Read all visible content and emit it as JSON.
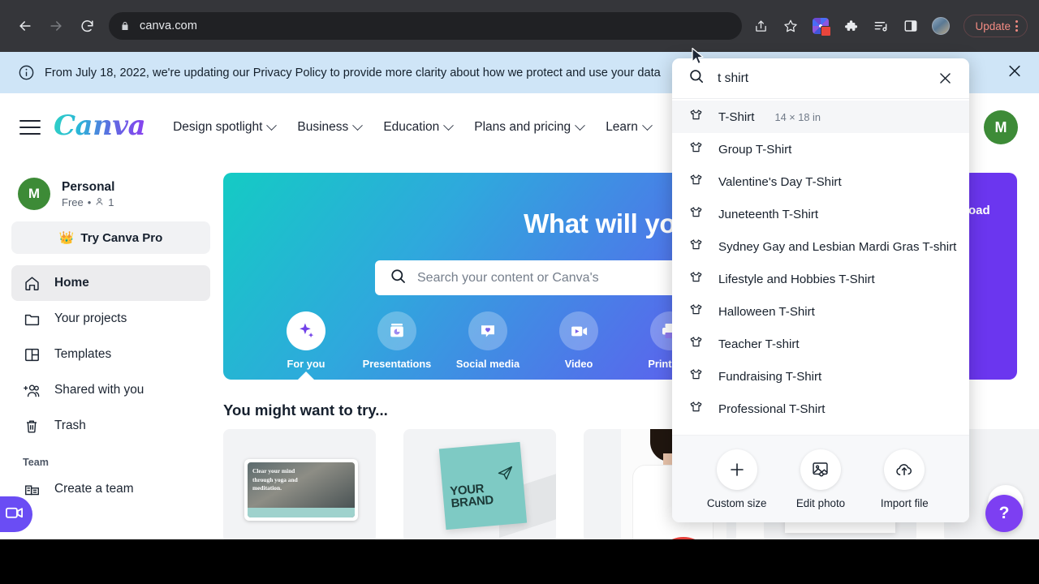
{
  "browser": {
    "url": "canva.com",
    "back_label": "Back",
    "forward_label": "Forward",
    "reload_label": "Reload",
    "update_label": "Update",
    "icons": [
      "share-icon",
      "bookmark-star-icon",
      "extension-colorful-icon",
      "extensions-puzzle-icon",
      "reading-list-icon",
      "side-panel-icon",
      "profile-avatar-icon"
    ]
  },
  "banner": {
    "text": "From July 18, 2022, we're updating our Privacy Policy to provide more clarity about how we protect and use your data",
    "info_icon": "info-icon",
    "close_icon": "close-icon"
  },
  "header": {
    "logo": "Canva",
    "menu_icon": "hamburger-menu-icon",
    "nav": [
      {
        "label": "Design spotlight"
      },
      {
        "label": "Business"
      },
      {
        "label": "Education"
      },
      {
        "label": "Plans and pricing"
      },
      {
        "label": "Learn"
      }
    ],
    "avatar_initial": "M"
  },
  "sidebar": {
    "workspace": {
      "avatar_initial": "M",
      "name": "Personal",
      "plan": "Free",
      "separator": "•",
      "members": "1",
      "people_icon": "person-icon"
    },
    "try_pro": {
      "label": "Try Canva Pro",
      "icon": "crown-icon"
    },
    "items": [
      {
        "label": "Home",
        "icon": "home-icon",
        "active": true
      },
      {
        "label": "Your projects",
        "icon": "folder-icon",
        "active": false
      },
      {
        "label": "Templates",
        "icon": "templates-icon",
        "active": false
      },
      {
        "label": "Shared with you",
        "icon": "shared-people-icon",
        "active": false
      },
      {
        "label": "Trash",
        "icon": "trash-icon",
        "active": false
      }
    ],
    "team_label": "Team",
    "create_team": {
      "label": "Create a team",
      "icon": "create-team-icon"
    },
    "video_pill_icon": "video-camera-icon"
  },
  "hero": {
    "title": "What will you d",
    "search_placeholder": "Search your content or Canva's",
    "search_icon": "search-icon",
    "upload_label": "oad",
    "categories": [
      {
        "label": "For you",
        "icon": "sparkle-icon",
        "active": true
      },
      {
        "label": "Presentations",
        "icon": "presentation-icon",
        "active": false
      },
      {
        "label": "Social media",
        "icon": "heart-bubble-icon",
        "active": false
      },
      {
        "label": "Video",
        "icon": "video-icon",
        "active": false
      },
      {
        "label": "Print pro",
        "icon": "printer-icon",
        "active": false
      }
    ]
  },
  "main": {
    "try_heading": "You might want to try...",
    "cards": [
      {
        "name": "yoga-meditation-banner",
        "text": "Clear your mind through yoga and meditation."
      },
      {
        "name": "your-brand-card",
        "line1": "YOUR",
        "line2": "BRAND"
      },
      {
        "name": "tshirt-photo-card",
        "text": ""
      },
      {
        "name": "print-mockup-card",
        "text": ""
      },
      {
        "name": "blank-card",
        "text": ""
      }
    ]
  },
  "search_dropdown": {
    "query": "t shirt",
    "search_icon": "search-icon",
    "clear_icon": "close-icon",
    "results": [
      {
        "label": "T-Shirt",
        "dimension": "14 × 18 in",
        "icon": "tshirt-icon",
        "highlighted": true
      },
      {
        "label": "Group T-Shirt",
        "dimension": "",
        "icon": "tshirt-icon",
        "highlighted": false
      },
      {
        "label": "Valentine's Day T-Shirt",
        "dimension": "",
        "icon": "tshirt-icon",
        "highlighted": false
      },
      {
        "label": "Juneteenth T-Shirt",
        "dimension": "",
        "icon": "tshirt-icon",
        "highlighted": false
      },
      {
        "label": "Sydney Gay and Lesbian Mardi Gras T-shirt",
        "dimension": "",
        "icon": "tshirt-icon",
        "highlighted": false
      },
      {
        "label": "Lifestyle and Hobbies T-Shirt",
        "dimension": "",
        "icon": "tshirt-icon",
        "highlighted": false
      },
      {
        "label": "Halloween T-Shirt",
        "dimension": "",
        "icon": "tshirt-icon",
        "highlighted": false
      },
      {
        "label": "Teacher T-shirt",
        "dimension": "",
        "icon": "tshirt-icon",
        "highlighted": false
      },
      {
        "label": "Fundraising T-Shirt",
        "dimension": "",
        "icon": "tshirt-icon",
        "highlighted": false
      },
      {
        "label": "Professional T-Shirt",
        "dimension": "",
        "icon": "tshirt-icon",
        "highlighted": false
      }
    ],
    "actions": [
      {
        "label": "Custom size",
        "icon": "plus-icon"
      },
      {
        "label": "Edit photo",
        "icon": "image-edit-icon"
      },
      {
        "label": "Import file",
        "icon": "cloud-upload-icon"
      }
    ]
  },
  "help": {
    "label": "?"
  },
  "colors": {
    "brand_purple": "#7d3ff2",
    "accent_teal": "#14cbc4",
    "banner_blue": "#cfe5f7",
    "avatar_green": "#3d8b37",
    "chrome_bar": "#35363a",
    "update_red": "#f28b82"
  }
}
